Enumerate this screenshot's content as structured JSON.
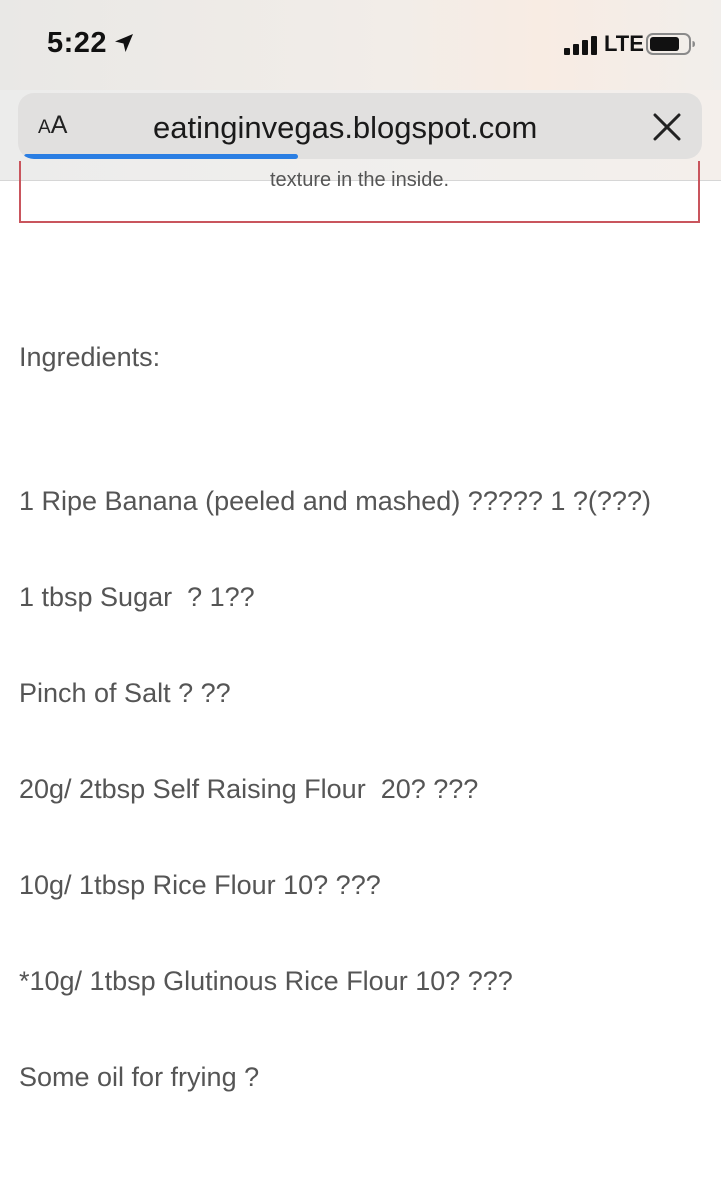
{
  "status_bar": {
    "time": "5:22",
    "network": "LTE",
    "location_icon": "location-arrow-icon",
    "signal_icon": "cellular-signal-icon",
    "battery_icon": "battery-icon"
  },
  "browser": {
    "text_size_button": {
      "small": "A",
      "large": "A"
    },
    "url": "eatinginvegas.blogspot.com",
    "close_icon": "close-icon",
    "load_progress": 0.4,
    "accent_color": "#2a7ee3"
  },
  "page": {
    "previous_text": "texture in the inside.",
    "heading": "Ingredients:",
    "ingredients": [
      "1 Ripe Banana (peeled and mashed) ????? 1 ?(???)",
      "1 tbsp Sugar  ? 1??",
      "Pinch of Salt ? ??",
      "20g/ 2tbsp Self Raising Flour  20? ???",
      "10g/ 1tbsp Rice Flour 10? ???",
      "*10g/ 1tbsp Glutinous Rice Flour 10? ???",
      "Some oil for frying ?"
    ],
    "text_color": "#555555",
    "box_border_color": "#c9555d"
  }
}
